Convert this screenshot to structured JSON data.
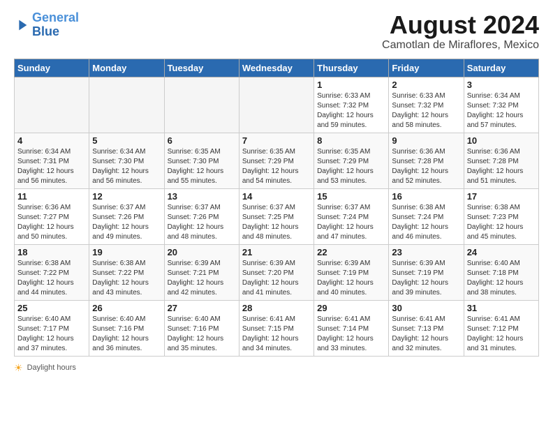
{
  "header": {
    "logo_line1": "General",
    "logo_line2": "Blue",
    "month_year": "August 2024",
    "location": "Camotlan de Miraflores, Mexico"
  },
  "days_of_week": [
    "Sunday",
    "Monday",
    "Tuesday",
    "Wednesday",
    "Thursday",
    "Friday",
    "Saturday"
  ],
  "weeks": [
    [
      {
        "day": "",
        "info": ""
      },
      {
        "day": "",
        "info": ""
      },
      {
        "day": "",
        "info": ""
      },
      {
        "day": "",
        "info": ""
      },
      {
        "day": "1",
        "info": "Sunrise: 6:33 AM\nSunset: 7:32 PM\nDaylight: 12 hours\nand 59 minutes."
      },
      {
        "day": "2",
        "info": "Sunrise: 6:33 AM\nSunset: 7:32 PM\nDaylight: 12 hours\nand 58 minutes."
      },
      {
        "day": "3",
        "info": "Sunrise: 6:34 AM\nSunset: 7:32 PM\nDaylight: 12 hours\nand 57 minutes."
      }
    ],
    [
      {
        "day": "4",
        "info": "Sunrise: 6:34 AM\nSunset: 7:31 PM\nDaylight: 12 hours\nand 56 minutes."
      },
      {
        "day": "5",
        "info": "Sunrise: 6:34 AM\nSunset: 7:30 PM\nDaylight: 12 hours\nand 56 minutes."
      },
      {
        "day": "6",
        "info": "Sunrise: 6:35 AM\nSunset: 7:30 PM\nDaylight: 12 hours\nand 55 minutes."
      },
      {
        "day": "7",
        "info": "Sunrise: 6:35 AM\nSunset: 7:29 PM\nDaylight: 12 hours\nand 54 minutes."
      },
      {
        "day": "8",
        "info": "Sunrise: 6:35 AM\nSunset: 7:29 PM\nDaylight: 12 hours\nand 53 minutes."
      },
      {
        "day": "9",
        "info": "Sunrise: 6:36 AM\nSunset: 7:28 PM\nDaylight: 12 hours\nand 52 minutes."
      },
      {
        "day": "10",
        "info": "Sunrise: 6:36 AM\nSunset: 7:28 PM\nDaylight: 12 hours\nand 51 minutes."
      }
    ],
    [
      {
        "day": "11",
        "info": "Sunrise: 6:36 AM\nSunset: 7:27 PM\nDaylight: 12 hours\nand 50 minutes."
      },
      {
        "day": "12",
        "info": "Sunrise: 6:37 AM\nSunset: 7:26 PM\nDaylight: 12 hours\nand 49 minutes."
      },
      {
        "day": "13",
        "info": "Sunrise: 6:37 AM\nSunset: 7:26 PM\nDaylight: 12 hours\nand 48 minutes."
      },
      {
        "day": "14",
        "info": "Sunrise: 6:37 AM\nSunset: 7:25 PM\nDaylight: 12 hours\nand 48 minutes."
      },
      {
        "day": "15",
        "info": "Sunrise: 6:37 AM\nSunset: 7:24 PM\nDaylight: 12 hours\nand 47 minutes."
      },
      {
        "day": "16",
        "info": "Sunrise: 6:38 AM\nSunset: 7:24 PM\nDaylight: 12 hours\nand 46 minutes."
      },
      {
        "day": "17",
        "info": "Sunrise: 6:38 AM\nSunset: 7:23 PM\nDaylight: 12 hours\nand 45 minutes."
      }
    ],
    [
      {
        "day": "18",
        "info": "Sunrise: 6:38 AM\nSunset: 7:22 PM\nDaylight: 12 hours\nand 44 minutes."
      },
      {
        "day": "19",
        "info": "Sunrise: 6:38 AM\nSunset: 7:22 PM\nDaylight: 12 hours\nand 43 minutes."
      },
      {
        "day": "20",
        "info": "Sunrise: 6:39 AM\nSunset: 7:21 PM\nDaylight: 12 hours\nand 42 minutes."
      },
      {
        "day": "21",
        "info": "Sunrise: 6:39 AM\nSunset: 7:20 PM\nDaylight: 12 hours\nand 41 minutes."
      },
      {
        "day": "22",
        "info": "Sunrise: 6:39 AM\nSunset: 7:19 PM\nDaylight: 12 hours\nand 40 minutes."
      },
      {
        "day": "23",
        "info": "Sunrise: 6:39 AM\nSunset: 7:19 PM\nDaylight: 12 hours\nand 39 minutes."
      },
      {
        "day": "24",
        "info": "Sunrise: 6:40 AM\nSunset: 7:18 PM\nDaylight: 12 hours\nand 38 minutes."
      }
    ],
    [
      {
        "day": "25",
        "info": "Sunrise: 6:40 AM\nSunset: 7:17 PM\nDaylight: 12 hours\nand 37 minutes."
      },
      {
        "day": "26",
        "info": "Sunrise: 6:40 AM\nSunset: 7:16 PM\nDaylight: 12 hours\nand 36 minutes."
      },
      {
        "day": "27",
        "info": "Sunrise: 6:40 AM\nSunset: 7:16 PM\nDaylight: 12 hours\nand 35 minutes."
      },
      {
        "day": "28",
        "info": "Sunrise: 6:41 AM\nSunset: 7:15 PM\nDaylight: 12 hours\nand 34 minutes."
      },
      {
        "day": "29",
        "info": "Sunrise: 6:41 AM\nSunset: 7:14 PM\nDaylight: 12 hours\nand 33 minutes."
      },
      {
        "day": "30",
        "info": "Sunrise: 6:41 AM\nSunset: 7:13 PM\nDaylight: 12 hours\nand 32 minutes."
      },
      {
        "day": "31",
        "info": "Sunrise: 6:41 AM\nSunset: 7:12 PM\nDaylight: 12 hours\nand 31 minutes."
      }
    ]
  ],
  "footer": {
    "daylight_label": "Daylight hours"
  }
}
